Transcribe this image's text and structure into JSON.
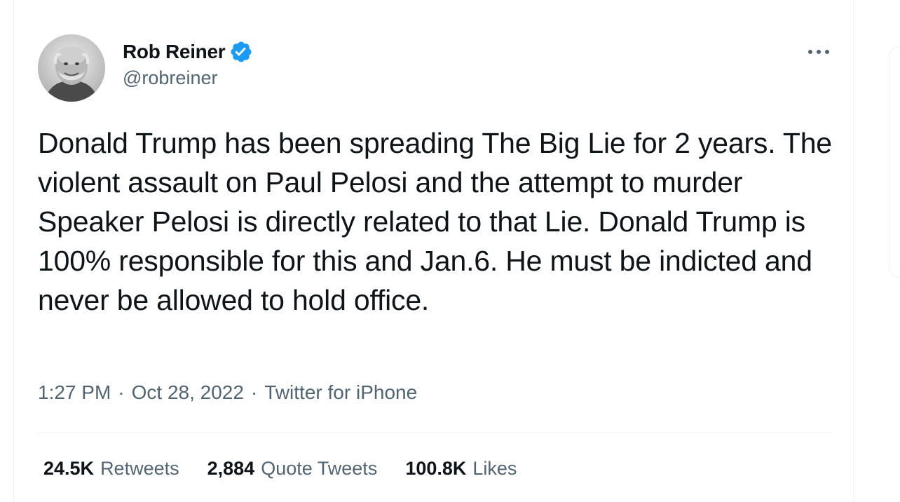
{
  "tweet": {
    "author": {
      "display_name": "Rob Reiner",
      "handle": "@robreiner",
      "verified": true
    },
    "text": "Donald Trump has been spreading The Big Lie for 2 years. The violent assault on Paul Pelosi and the attempt to murder Speaker Pelosi is directly related to that Lie. Donald Trump is 100% responsible for this and Jan.6. He must be indicted and never be allowed to hold office.",
    "time": "1:27 PM",
    "date": "Oct 28, 2022",
    "source": "Twitter for iPhone",
    "separator": "·",
    "stats": [
      {
        "count": "24.5K",
        "label": "Retweets"
      },
      {
        "count": "2,884",
        "label": "Quote Tweets"
      },
      {
        "count": "100.8K",
        "label": "Likes"
      }
    ]
  },
  "icons": {
    "verified": "verified-badge-icon",
    "more": "more-horizontal-icon"
  },
  "colors": {
    "verified_blue": "#1d9bf0",
    "text_primary": "#0f1419",
    "text_secondary": "#536471",
    "border": "#eff3f4"
  }
}
